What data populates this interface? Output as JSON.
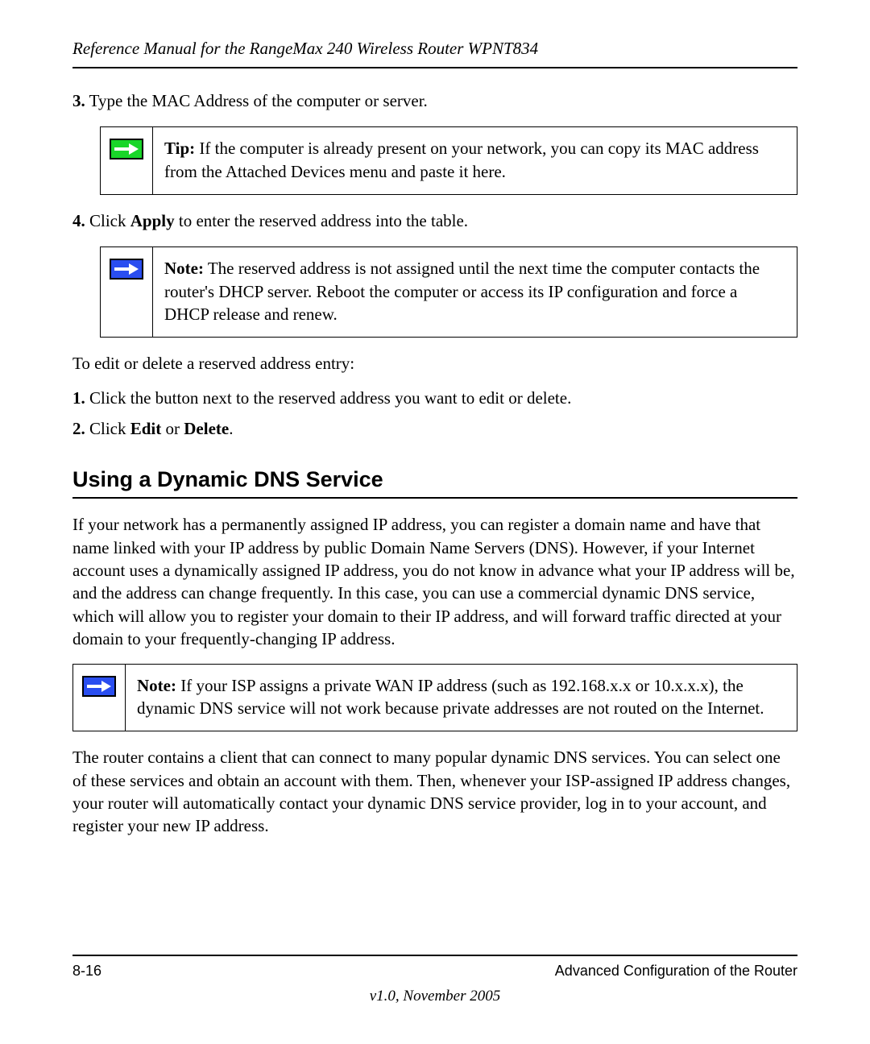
{
  "header": {
    "running_title": "Reference Manual for the RangeMax 240 Wireless Router WPNT834"
  },
  "steps": {
    "step3_num": "3.",
    "step3_text": "Type the MAC Address of the computer or server.",
    "step4_num": "4.",
    "step4_pre": "Click ",
    "step4_bold": "Apply",
    "step4_post": " to enter the reserved address into the table."
  },
  "tip": {
    "label": "Tip:",
    "text": " If the computer is already present on your network, you can copy its MAC address from the Attached Devices menu and paste it here."
  },
  "note1": {
    "label": "Note:",
    "text": " The reserved address is not assigned until the next time the computer contacts the router's DHCP server. Reboot the computer or access its IP configuration and force a DHCP release and renew."
  },
  "edit_intro": "To edit or delete a reserved address entry:",
  "edit_steps": {
    "s1_num": "1.",
    "s1_text": "Click the button next to the reserved address you want to edit or delete.",
    "s2_num": "2.",
    "s2_pre": "Click ",
    "s2_b1": "Edit",
    "s2_mid": " or ",
    "s2_b2": "Delete",
    "s2_post": "."
  },
  "section_heading": "Using a Dynamic DNS Service",
  "ddns_para": "If your network has a permanently assigned IP address, you can register a domain name and have that name linked with your IP address by public Domain Name Servers (DNS). However, if your Internet account uses a dynamically assigned IP address, you do not know in advance what your IP address will be, and the address can change frequently. In this case, you can use a commercial dynamic DNS service, which will allow you to register your domain to their IP address, and will forward traffic directed at your domain to your frequently-changing IP address.",
  "note2": {
    "label": "Note:",
    "text": " If your ISP assigns a private WAN IP address (such as 192.168.x.x or 10.x.x.x), the dynamic DNS service will not work because private addresses are not routed on the Internet."
  },
  "ddns_para2": "The router contains a client that can connect to many popular dynamic DNS services. You can select one of these services and obtain an account with them. Then, whenever your ISP-assigned IP address changes, your router will automatically contact your dynamic DNS service provider, log in to your account, and register your new IP address.",
  "footer": {
    "page_num": "8-16",
    "section_title": "Advanced Configuration of the Router",
    "version": "v1.0, November 2005"
  }
}
